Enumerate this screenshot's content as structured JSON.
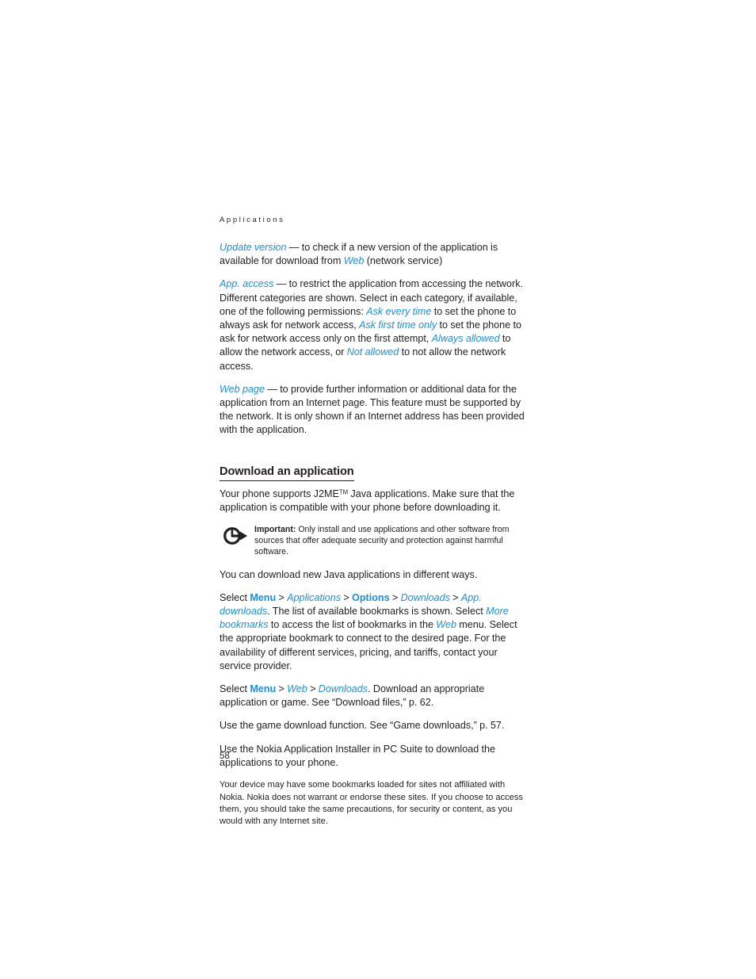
{
  "document": {
    "running_header": "Applications",
    "page_number": "58"
  },
  "content": {
    "para_update_version": {
      "term": "Update version",
      "dash": " — ",
      "text_1": "to check if a new version of the application is available for download from ",
      "term_web": "Web",
      "text_2": " (network service)"
    },
    "para_app_access": {
      "term": "App. access",
      "dash": " — ",
      "text_1": "to restrict the application from accessing the network. Different categories are shown. Select in each category, if available, one of the following permissions: ",
      "opt_1": "Ask every time",
      "text_2": " to set the phone to always ask for network access, ",
      "opt_2": "Ask first time only",
      "text_3": " to set the phone to ask for network access only on the first attempt, ",
      "opt_3": "Always allowed",
      "text_4": " to allow the network access, or ",
      "opt_4": "Not allowed",
      "text_5": " to not allow the network access."
    },
    "para_web_page": {
      "term": "Web page",
      "dash": " — ",
      "text_1": "to provide further information or additional data for the application from an Internet page. This feature must be supported by the network. It is only shown if an Internet address has been provided with the application."
    },
    "heading_download": "Download an application",
    "para_j2me": {
      "text_1": "Your phone supports J2ME",
      "tm": "TM",
      "text_2": " Java applications. Make sure that the application is compatible with your phone before downloading it."
    },
    "note_important": {
      "icon": "important-note-icon",
      "label": "Important:",
      "text": " Only install and use applications and other software from sources that offer adequate security and protection against harmful software."
    },
    "para_ways": "You can download new Java applications in different ways.",
    "para_select_apps": {
      "text_1": "Select ",
      "menu": "Menu",
      "sep_1": " > ",
      "applications": "Applications",
      "sep_2": " > ",
      "options": "Options",
      "sep_3": " > ",
      "downloads": "Downloads",
      "sep_4": " > ",
      "app_downloads": "App. downloads",
      "text_2": ". The list of available bookmarks is shown. Select ",
      "more_bookmarks": "More bookmarks",
      "text_3": " to access the list of bookmarks in the ",
      "web": "Web",
      "text_4": " menu. Select the appropriate bookmark to connect to the desired page. For the availability of different services, pricing, and tariffs, contact your service provider."
    },
    "para_select_web": {
      "text_1": "Select ",
      "menu": "Menu",
      "sep_1": " > ",
      "web": "Web",
      "sep_2": " > ",
      "downloads": "Downloads",
      "text_2": ". Download an appropriate application or game. See “Download files,” p. 62."
    },
    "para_game_download": "Use the game download function. See “Game downloads,” p. 57.",
    "para_pc_suite": "Use the Nokia Application Installer in PC Suite to download the applications to your phone.",
    "para_disclaimer": "Your device may have some bookmarks loaded for sites not affiliated with Nokia. Nokia does not warrant or endorse these sites. If you choose to access them, you should take the same precautions, for security or content, as you would with any Internet site."
  },
  "colors": {
    "link_blue": "#1e8fe0",
    "text_black": "#231f20",
    "page_background": "#ffffff"
  }
}
